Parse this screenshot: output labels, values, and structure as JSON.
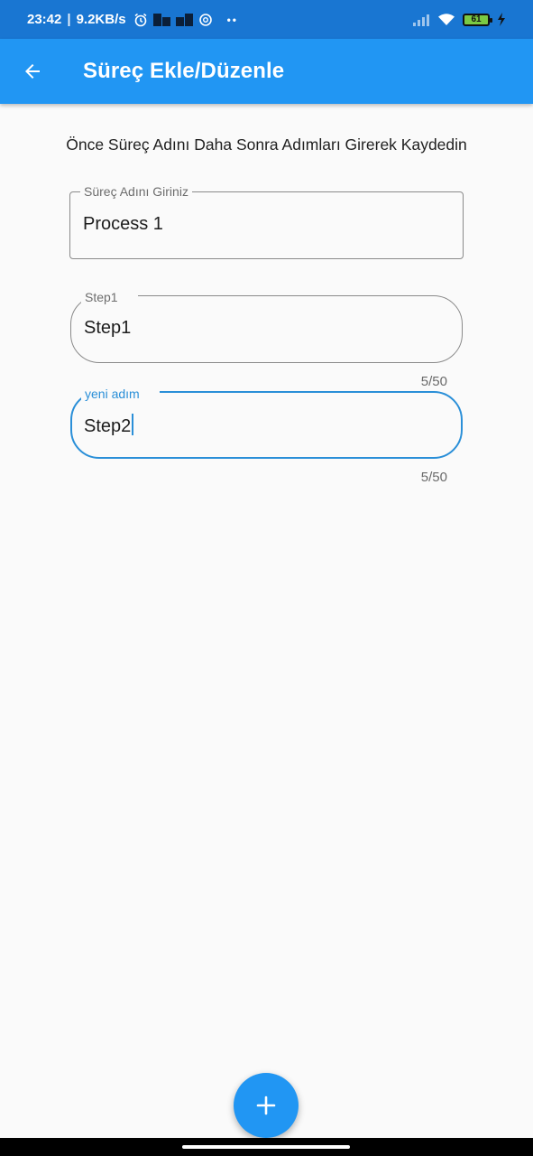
{
  "status_bar": {
    "time": "23:42",
    "separator": "|",
    "network_speed": "9.2KB/s",
    "battery_level": "61",
    "icons": [
      "alarm-icon",
      "notification-icon",
      "notification-icon-2",
      "sync-icon",
      "more-dots-icon",
      "signal-icon",
      "wifi-icon",
      "battery-icon",
      "charging-icon"
    ]
  },
  "app_bar": {
    "title": "Süreç Ekle/Düzenle",
    "back_icon": "arrow-back-icon"
  },
  "instruction_text": "Önce Süreç Adını Daha Sonra Adımları Girerek Kaydedin",
  "process_field": {
    "label": "Süreç Adını Giriniz",
    "value": "Process 1"
  },
  "steps": [
    {
      "label": "Step1",
      "value": "Step1",
      "counter": "5/50",
      "focused": false
    },
    {
      "label": "yeni adım",
      "value": "Step2",
      "counter": "5/50",
      "focused": true
    }
  ],
  "fab": {
    "icon": "plus-icon"
  },
  "colors": {
    "status_bar": "#1976d2",
    "app_bar": "#2196f3",
    "accent": "#2a8fd8",
    "background": "#fafafa"
  }
}
